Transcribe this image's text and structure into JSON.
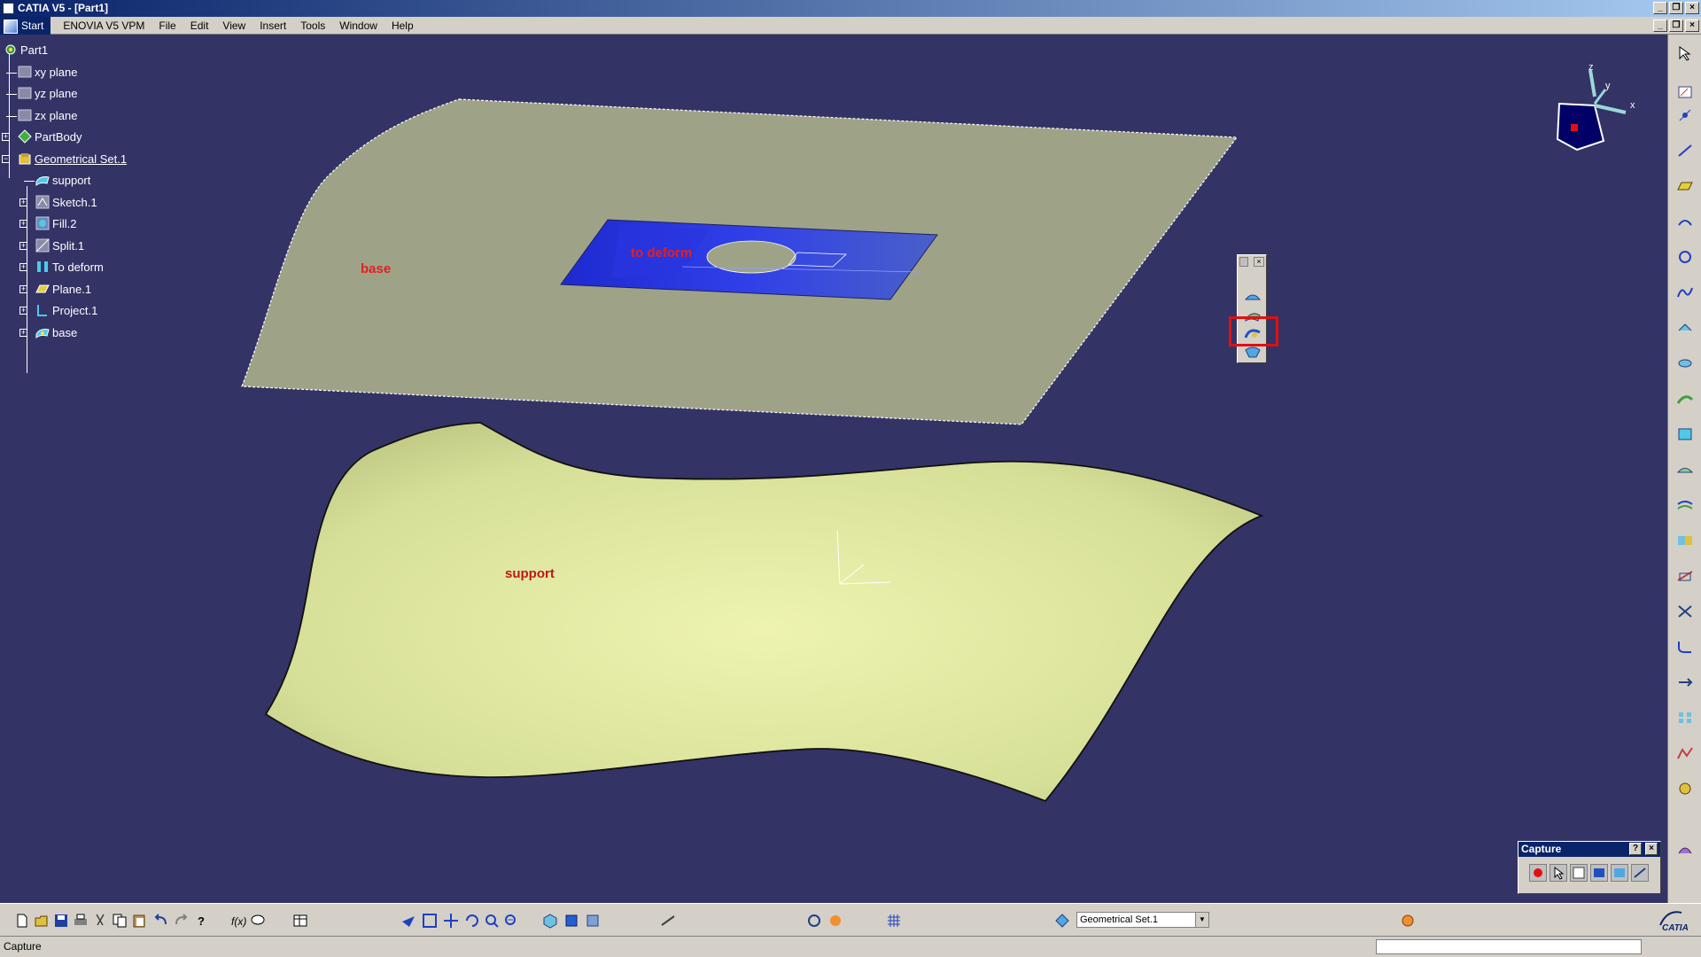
{
  "window": {
    "title": "CATIA V5 - [Part1]"
  },
  "menu": [
    "Start",
    "ENOVIA V5 VPM",
    "File",
    "Edit",
    "View",
    "Insert",
    "Tools",
    "Window",
    "Help"
  ],
  "tree": {
    "root": "Part1",
    "items": [
      {
        "label": "xy plane",
        "icon": "plane-icon"
      },
      {
        "label": "yz plane",
        "icon": "plane-icon"
      },
      {
        "label": "zx plane",
        "icon": "plane-icon"
      },
      {
        "label": "PartBody",
        "icon": "partbody-icon"
      },
      {
        "label": "Geometrical Set.1",
        "icon": "geometrical-set-icon"
      },
      {
        "label": "support",
        "icon": "surface-icon"
      },
      {
        "label": "Sketch.1",
        "icon": "sketch-icon"
      },
      {
        "label": "Fill.2",
        "icon": "fill-icon"
      },
      {
        "label": "Split.1",
        "icon": "split-icon"
      },
      {
        "label": "To deform",
        "icon": "surface-icon"
      },
      {
        "label": "Plane.1",
        "icon": "plane-feature-icon"
      },
      {
        "label": "Project.1",
        "icon": "project-icon"
      },
      {
        "label": "base",
        "icon": "surface-icon"
      }
    ]
  },
  "scene": {
    "labels": {
      "base": "base",
      "to_deform": "to deform",
      "support": "support"
    },
    "axes": {
      "x": "x",
      "y": "y",
      "z": "z"
    }
  },
  "toolbar": {
    "current_set": "Geometrical Set.1"
  },
  "capture": {
    "title": "Capture",
    "help": "?",
    "close": "×"
  },
  "status": {
    "text": "Capture"
  },
  "logo": "CATIA",
  "colors": {
    "background": "#333366",
    "highlight": "#e01010",
    "label_red": "#e02020"
  }
}
